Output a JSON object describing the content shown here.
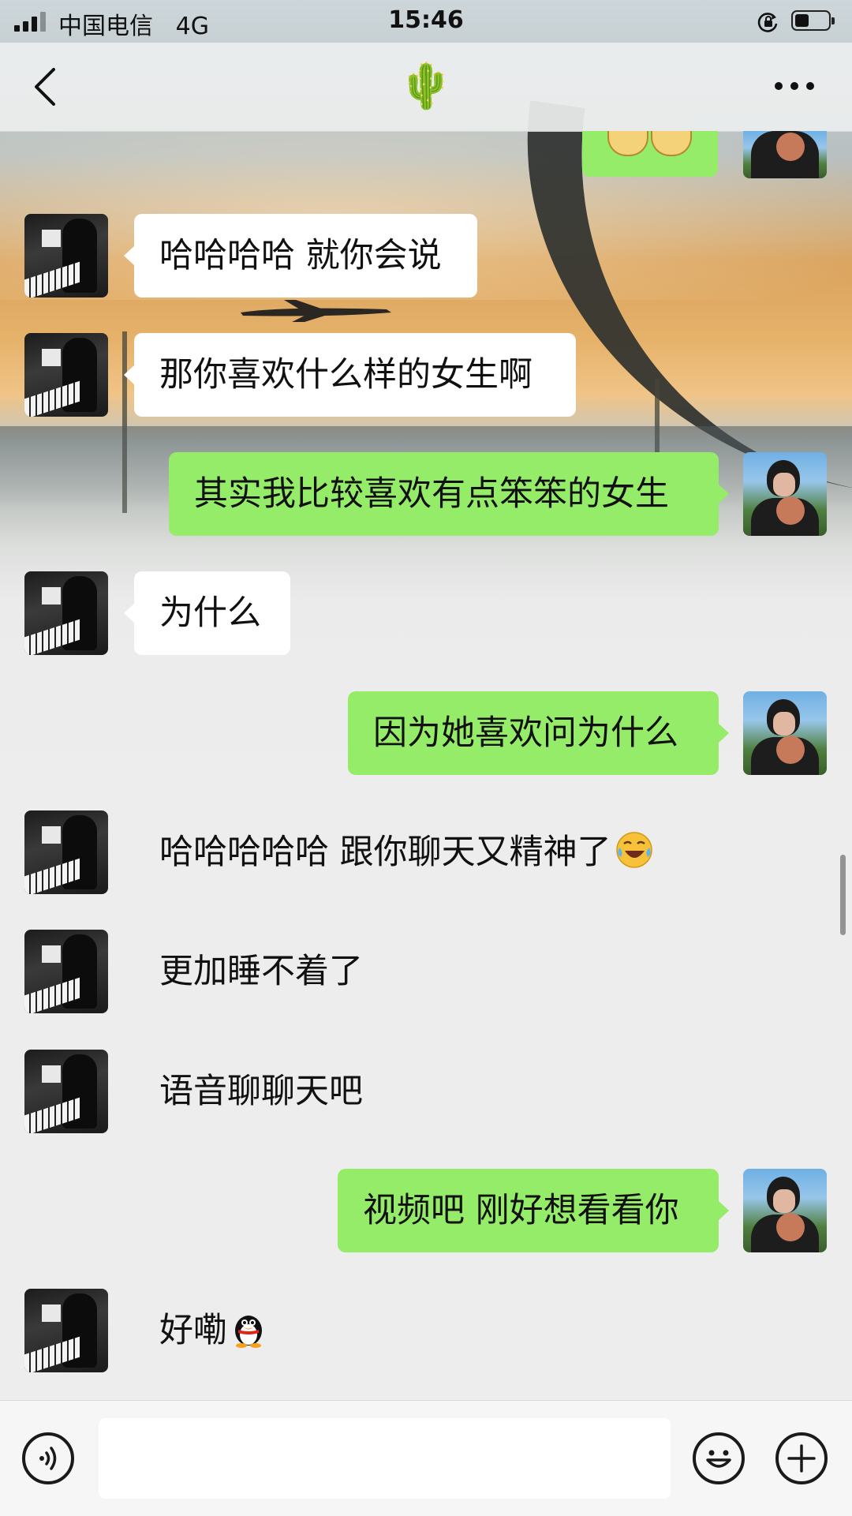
{
  "status_bar": {
    "carrier": "中国电信",
    "network": "4G",
    "time": "15:46",
    "battery_level": 0.38,
    "icons": [
      "signal-icon",
      "orientation-lock-icon",
      "battery-icon"
    ]
  },
  "nav": {
    "title": "🌵",
    "back_icon": "chevron-left-icon",
    "more_icon": "more-dots-icon"
  },
  "messages": [
    {
      "side": "left",
      "text": "哈哈哈哈 就你会说"
    },
    {
      "side": "left",
      "text": "那你喜欢什么样的女生啊"
    },
    {
      "side": "right",
      "text": "其实我比较喜欢有点笨笨的女生"
    },
    {
      "side": "left",
      "text": "为什么"
    },
    {
      "side": "right",
      "text": "因为她喜欢问为什么"
    },
    {
      "side": "left",
      "text": "哈哈哈哈哈 跟你聊天又精神了",
      "emoji": "laughing-tears-emoji"
    },
    {
      "side": "left",
      "text": "更加睡不着了"
    },
    {
      "side": "left",
      "text": "语音聊聊天吧"
    },
    {
      "side": "right",
      "text": "视频吧 刚好想看看你"
    },
    {
      "side": "left",
      "text": "好嘞",
      "emoji": "penguin-emoji"
    }
  ],
  "input_bar": {
    "value": "",
    "icons": [
      "voice-icon",
      "emoji-face-icon",
      "plus-icon"
    ]
  },
  "colors": {
    "outgoing_bubble": "#95ec69",
    "incoming_bubble": "#ffffff",
    "chat_background": "#ededed"
  }
}
